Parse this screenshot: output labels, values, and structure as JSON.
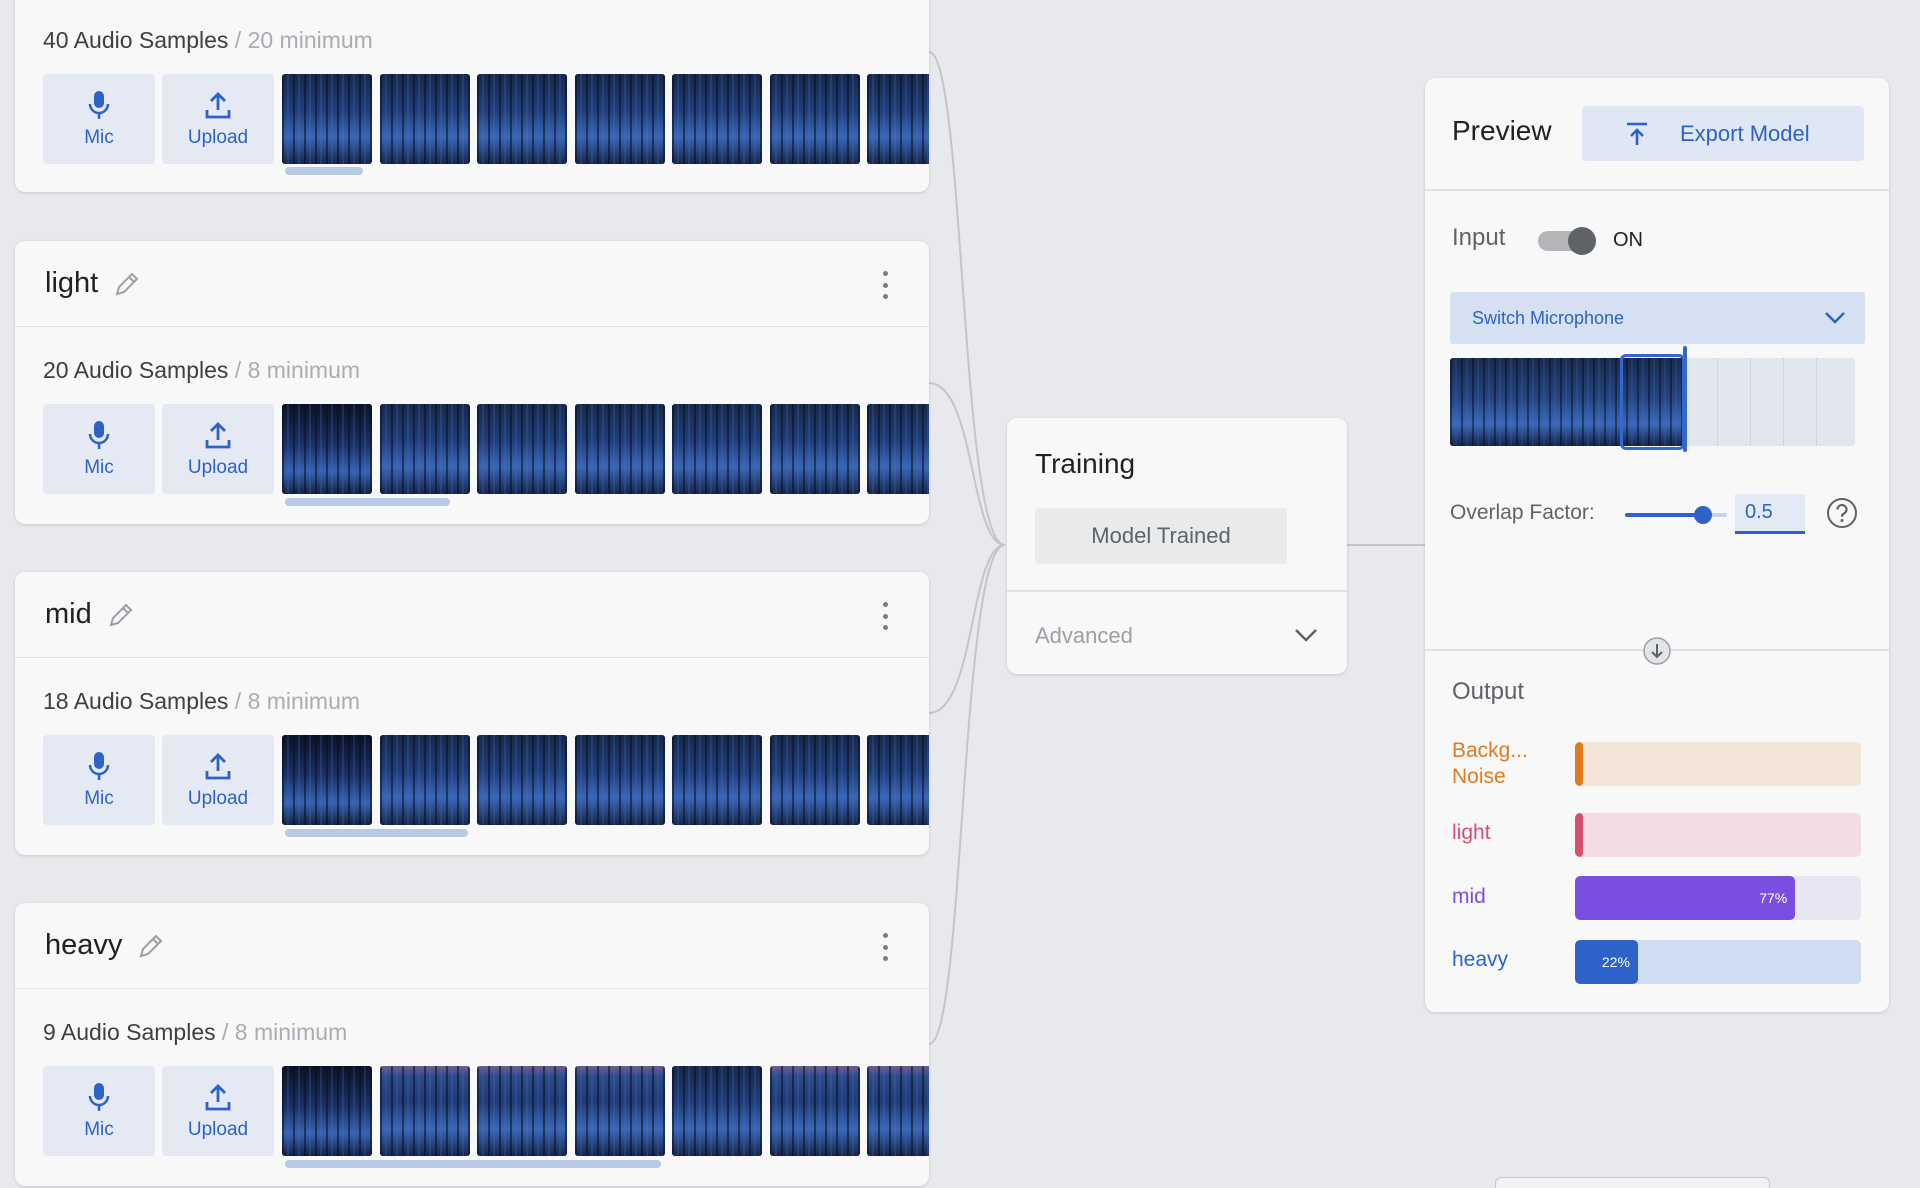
{
  "classes": [
    {
      "name": "",
      "samples_text": "40 Audio Samples",
      "minimum_text": " / 20 minimum",
      "mic_label": "Mic",
      "upload_label": "Upload",
      "scroll_fraction": 0.17
    },
    {
      "name": "light",
      "samples_text": "20 Audio Samples",
      "minimum_text": " / 8 minimum",
      "mic_label": "Mic",
      "upload_label": "Upload",
      "scroll_fraction": 0.36
    },
    {
      "name": "mid",
      "samples_text": "18 Audio Samples",
      "minimum_text": " / 8 minimum",
      "mic_label": "Mic",
      "upload_label": "Upload",
      "scroll_fraction": 0.4
    },
    {
      "name": "heavy",
      "samples_text": "9 Audio Samples",
      "minimum_text": " / 8 minimum",
      "mic_label": "Mic",
      "upload_label": "Upload",
      "scroll_fraction": 0.82
    }
  ],
  "training": {
    "title": "Training",
    "status_button": "Model Trained",
    "advanced_label": "Advanced"
  },
  "preview": {
    "title": "Preview",
    "export_label": "Export Model",
    "input_label": "Input",
    "input_state": "ON",
    "input_on": true,
    "mic_select_value": "Switch Microphone",
    "overlap_label": "Overlap Factor:",
    "overlap_value": "0.5",
    "output_title": "Output",
    "outputs": [
      {
        "label": "Backg... Noise",
        "percent": 0,
        "percent_text": "",
        "color": "#e07b1f",
        "track": "#f3e4d8"
      },
      {
        "label": "light",
        "percent": 0,
        "percent_text": "",
        "color": "#d64f6f",
        "track": "#f3dde2"
      },
      {
        "label": "mid",
        "percent": 77,
        "percent_text": "77%",
        "color": "#7b4ee2",
        "track": "#e7e6f3"
      },
      {
        "label": "heavy",
        "percent": 22,
        "percent_text": "22%",
        "color": "#2d63c8",
        "track": "#cfdcf1"
      }
    ]
  },
  "colors": {
    "accent": "#2d63c8",
    "background": "#e8e9ec",
    "card": "#f8f8f9"
  },
  "icons": {
    "mic": "microphone-icon",
    "upload": "upload-icon",
    "edit": "pencil-icon",
    "menu": "kebab-icon",
    "export": "export-icon",
    "dropdown": "chevron-down-icon",
    "help": "help-icon",
    "flow": "arrow-down-icon"
  }
}
